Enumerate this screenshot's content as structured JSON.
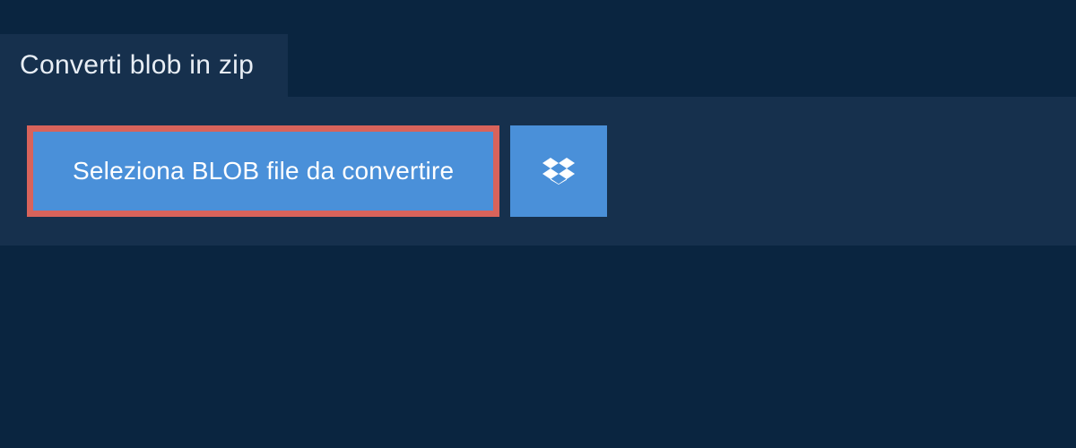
{
  "tab": {
    "title": "Converti blob in zip"
  },
  "actions": {
    "select_file_label": "Seleziona BLOB file da convertire"
  },
  "colors": {
    "background": "#0a2540",
    "panel": "#16304d",
    "button": "#4a90d9",
    "highlight_border": "#d8635b"
  }
}
